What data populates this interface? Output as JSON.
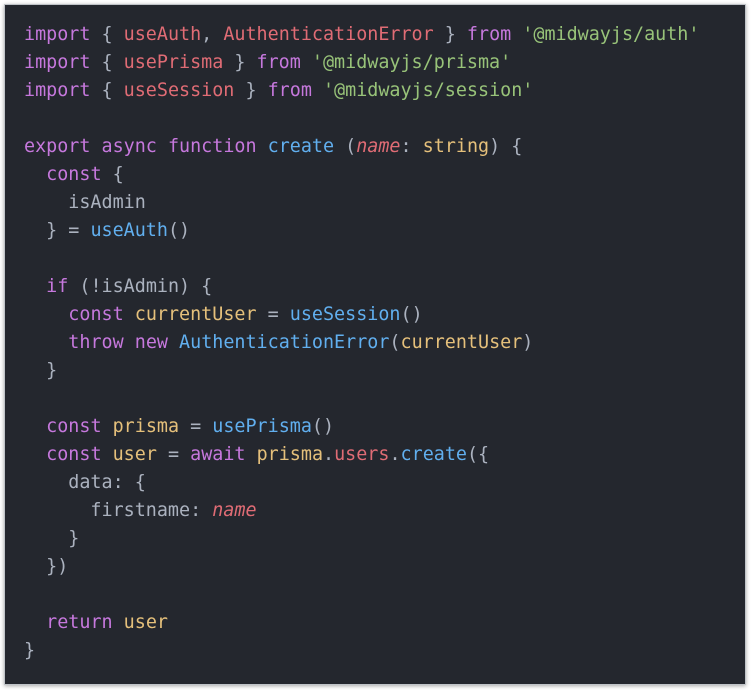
{
  "colors": {
    "background": "#24272e",
    "keyword": "#c678dd",
    "identifier": "#e06c75",
    "string": "#98c379",
    "function": "#61afef",
    "variable": "#e5c07b",
    "plain": "#abb2bf"
  },
  "code_lines": [
    [
      [
        "import",
        "kw"
      ],
      [
        " { ",
        "p"
      ],
      [
        "useAuth",
        "red"
      ],
      [
        ", ",
        "p"
      ],
      [
        "AuthenticationError",
        "red"
      ],
      [
        " } ",
        "p"
      ],
      [
        "from",
        "kw"
      ],
      [
        " ",
        "p"
      ],
      [
        "'@midwayjs/auth'",
        "str"
      ]
    ],
    [
      [
        "import",
        "kw"
      ],
      [
        " { ",
        "p"
      ],
      [
        "usePrisma",
        "red"
      ],
      [
        " } ",
        "p"
      ],
      [
        "from",
        "kw"
      ],
      [
        " ",
        "p"
      ],
      [
        "'@midwayjs/prisma'",
        "str"
      ]
    ],
    [
      [
        "import",
        "kw"
      ],
      [
        " { ",
        "p"
      ],
      [
        "useSession",
        "red"
      ],
      [
        " } ",
        "p"
      ],
      [
        "from",
        "kw"
      ],
      [
        " ",
        "p"
      ],
      [
        "'@midwayjs/session'",
        "str"
      ]
    ],
    [],
    [
      [
        "export",
        "kw"
      ],
      [
        " ",
        "p"
      ],
      [
        "async",
        "kw"
      ],
      [
        " ",
        "p"
      ],
      [
        "function",
        "kw"
      ],
      [
        " ",
        "p"
      ],
      [
        "create",
        "fn"
      ],
      [
        " (",
        "p"
      ],
      [
        "name",
        "it"
      ],
      [
        ": ",
        "p"
      ],
      [
        "string",
        "var"
      ],
      [
        ") {",
        "p"
      ]
    ],
    [
      [
        "  ",
        "p"
      ],
      [
        "const",
        "kw"
      ],
      [
        " {",
        "p"
      ]
    ],
    [
      [
        "    isAdmin",
        "p"
      ]
    ],
    [
      [
        "  } = ",
        "p"
      ],
      [
        "useAuth",
        "fn"
      ],
      [
        "()",
        "p"
      ]
    ],
    [],
    [
      [
        "  ",
        "p"
      ],
      [
        "if",
        "kw"
      ],
      [
        " (!isAdmin) {",
        "p"
      ]
    ],
    [
      [
        "    ",
        "p"
      ],
      [
        "const",
        "kw"
      ],
      [
        " ",
        "p"
      ],
      [
        "currentUser",
        "var"
      ],
      [
        " = ",
        "p"
      ],
      [
        "useSession",
        "fn"
      ],
      [
        "()",
        "p"
      ]
    ],
    [
      [
        "    ",
        "p"
      ],
      [
        "throw",
        "kw"
      ],
      [
        " ",
        "p"
      ],
      [
        "new",
        "kw"
      ],
      [
        " ",
        "p"
      ],
      [
        "AuthenticationError",
        "fn"
      ],
      [
        "(",
        "p"
      ],
      [
        "currentUser",
        "var"
      ],
      [
        ")",
        "p"
      ]
    ],
    [
      [
        "  }",
        "p"
      ]
    ],
    [],
    [
      [
        "  ",
        "p"
      ],
      [
        "const",
        "kw"
      ],
      [
        " ",
        "p"
      ],
      [
        "prisma",
        "var"
      ],
      [
        " = ",
        "p"
      ],
      [
        "usePrisma",
        "fn"
      ],
      [
        "()",
        "p"
      ]
    ],
    [
      [
        "  ",
        "p"
      ],
      [
        "const",
        "kw"
      ],
      [
        " ",
        "p"
      ],
      [
        "user",
        "var"
      ],
      [
        " = ",
        "p"
      ],
      [
        "await",
        "kw"
      ],
      [
        " ",
        "p"
      ],
      [
        "prisma",
        "var"
      ],
      [
        ".",
        "p"
      ],
      [
        "users",
        "red"
      ],
      [
        ".",
        "p"
      ],
      [
        "create",
        "fn"
      ],
      [
        "({",
        "p"
      ]
    ],
    [
      [
        "    data: {",
        "p"
      ]
    ],
    [
      [
        "      firstname: ",
        "p"
      ],
      [
        "name",
        "it"
      ]
    ],
    [
      [
        "    }",
        "p"
      ]
    ],
    [
      [
        "  })",
        "p"
      ]
    ],
    [],
    [
      [
        "  ",
        "p"
      ],
      [
        "return",
        "kw"
      ],
      [
        " ",
        "p"
      ],
      [
        "user",
        "var"
      ]
    ],
    [
      [
        "}",
        "p"
      ]
    ]
  ]
}
